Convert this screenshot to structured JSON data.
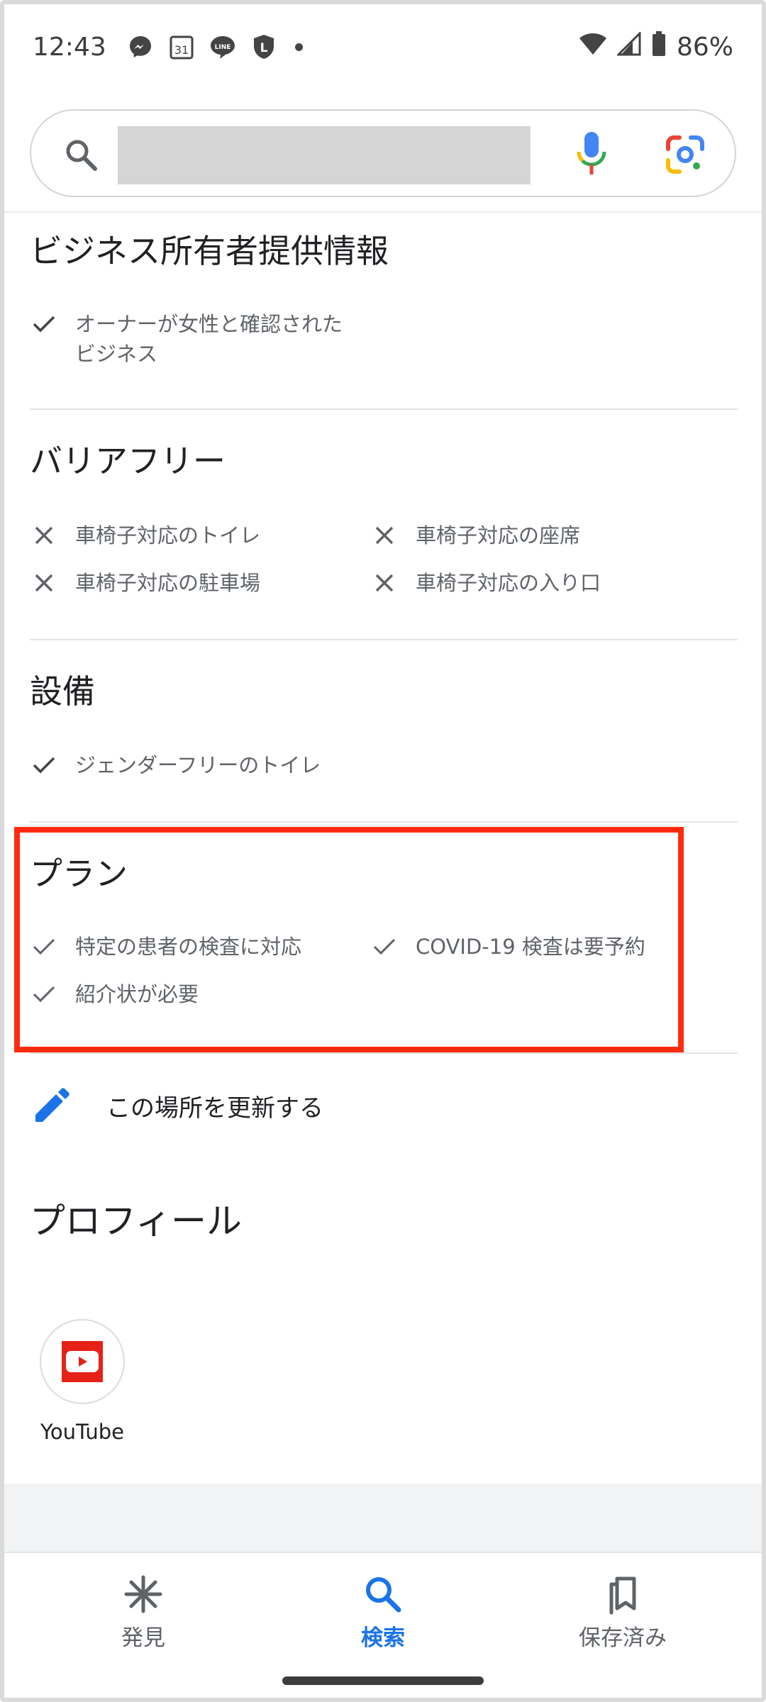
{
  "status_bar": {
    "time": "12:43",
    "calendar_day": "31",
    "line_label": "LINE",
    "l_label": "L",
    "battery": "86%"
  },
  "search": {
    "placeholder": ""
  },
  "sections": {
    "business": {
      "title": "ビジネス所有者提供情報",
      "items": [
        "オーナーが女性と確認された\nビジネス"
      ]
    },
    "accessibility": {
      "title": "バリアフリー",
      "items": [
        "車椅子対応のトイレ",
        "車椅子対応の座席",
        "車椅子対応の駐車場",
        "車椅子対応の入り口"
      ]
    },
    "amenities": {
      "title": "設備",
      "items": [
        "ジェンダーフリーのトイレ"
      ]
    },
    "plans": {
      "title": "プラン",
      "items": [
        "特定の患者の検査に対応",
        "COVID-19 検査は要予約",
        "紹介状が必要"
      ]
    }
  },
  "update_link": "この場所を更新する",
  "profile": {
    "title": "プロフィール",
    "links": [
      {
        "label": "YouTube"
      }
    ]
  },
  "bottom_nav": {
    "items": [
      {
        "label": "発見",
        "icon": "asterisk-icon",
        "active": false
      },
      {
        "label": "検索",
        "icon": "search-icon",
        "active": true
      },
      {
        "label": "保存済み",
        "icon": "bookmarks-icon",
        "active": false
      }
    ]
  },
  "colors": {
    "accent": "#1a73e8",
    "highlight": "#ff2b0e",
    "youtube": "#e62117"
  }
}
